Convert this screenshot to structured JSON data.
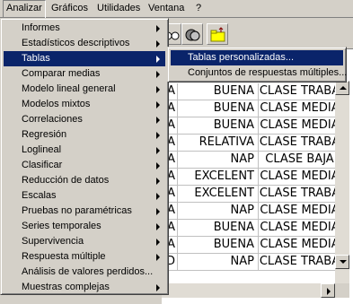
{
  "menubar": [
    {
      "label": "Analizar",
      "active": true
    },
    {
      "label": "Gráficos"
    },
    {
      "label": "Utilidades"
    },
    {
      "label": "Ventana"
    },
    {
      "label": "?"
    }
  ],
  "toolbar": {
    "icons": [
      "eye-glasses-icon",
      "scale-icon",
      "folder-icon"
    ]
  },
  "analyze_menu": {
    "items": [
      {
        "label": "Informes",
        "submenu": true
      },
      {
        "label": "Estadísticos descriptivos",
        "submenu": true
      },
      {
        "label": "Tablas",
        "submenu": true,
        "selected": true
      },
      {
        "label": "Comparar medias",
        "submenu": true
      },
      {
        "label": "Modelo lineal general",
        "submenu": true
      },
      {
        "label": "Modelos mixtos",
        "submenu": true
      },
      {
        "label": "Correlaciones",
        "submenu": true
      },
      {
        "label": "Regresión",
        "submenu": true
      },
      {
        "label": "Loglineal",
        "submenu": true
      },
      {
        "label": "Clasificar",
        "submenu": true
      },
      {
        "label": "Reducción de datos",
        "submenu": true
      },
      {
        "label": "Escalas",
        "submenu": true
      },
      {
        "label": "Pruebas no paramétricas",
        "submenu": true
      },
      {
        "label": "Series temporales",
        "submenu": true
      },
      {
        "label": "Supervivencia",
        "submenu": true
      },
      {
        "label": "Respuesta múltiple",
        "submenu": true
      },
      {
        "label": "Análisis de valores perdidos...",
        "submenu": false
      },
      {
        "label": "Muestras complejas",
        "submenu": true
      }
    ]
  },
  "tables_submenu": {
    "items": [
      {
        "label": "Tablas personalizadas...",
        "selected": true
      },
      {
        "label": "Conjuntos de respuestas múltiples..."
      }
    ]
  },
  "grid": {
    "rows": [
      {
        "c0": "A",
        "c1": "BUENA",
        "c2": "CLASE TRABA"
      },
      {
        "c0": "A",
        "c1": "BUENA",
        "c2": "CLASE MEDIA"
      },
      {
        "c0": "A",
        "c1": "BUENA",
        "c2": "CLASE MEDIA"
      },
      {
        "c0": "A",
        "c1": "RELATIVA",
        "c2": "CLASE TRABA"
      },
      {
        "c0": "A",
        "c1": "NAP",
        "c2": "CLASE BAJA"
      },
      {
        "c0": "A",
        "c1": "EXCELENT",
        "c2": "CLASE MEDIA"
      },
      {
        "c0": "A",
        "c1": "EXCELENT",
        "c2": "CLASE TRABA"
      },
      {
        "c0": "A",
        "c1": "NAP",
        "c2": "CLASE MEDIA"
      },
      {
        "c0": "A",
        "c1": "BUENA",
        "c2": "CLASE MEDIA"
      },
      {
        "c0": "A",
        "c1": "BUENA",
        "c2": "CLASE MEDIA"
      },
      {
        "c0": "D",
        "c1": "NAP",
        "c2": "CLASE TRABA"
      }
    ]
  }
}
